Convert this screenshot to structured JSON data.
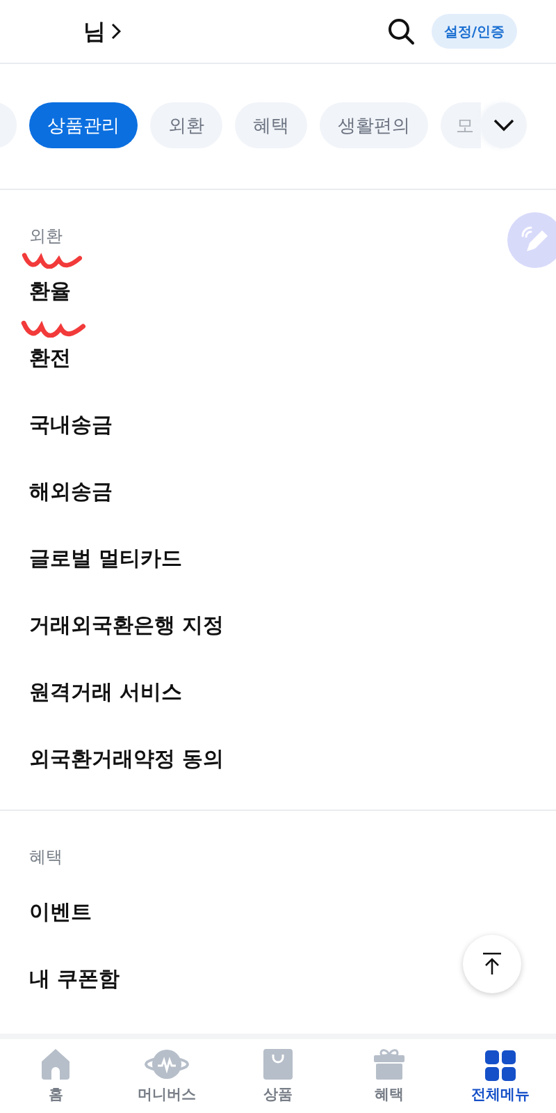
{
  "header": {
    "greeting": "님",
    "settings_button": "설정/인증"
  },
  "chips": [
    {
      "selected": false
    },
    {
      "label": "상품관리",
      "selected": true
    },
    {
      "label": "외환",
      "selected": false
    },
    {
      "label": "혜택",
      "selected": false
    },
    {
      "label": "생활편의",
      "selected": false
    },
    {
      "label": "모",
      "selected": false
    }
  ],
  "sections": [
    {
      "title": "외환",
      "items": [
        "환율",
        "환전",
        "국내송금",
        "해외송금",
        "글로벌 멀티카드",
        "거래외국환은행 지정",
        "원격거래 서비스",
        "외국환거래약정 동의"
      ]
    },
    {
      "title": "혜택",
      "items": [
        "이벤트",
        "내 쿠폰함"
      ]
    }
  ],
  "bottom_nav": [
    {
      "label": "홈",
      "selected": false
    },
    {
      "label": "머니버스",
      "selected": false
    },
    {
      "label": "상품",
      "selected": false
    },
    {
      "label": "혜택",
      "selected": false
    },
    {
      "label": "전체메뉴",
      "selected": true
    }
  ]
}
